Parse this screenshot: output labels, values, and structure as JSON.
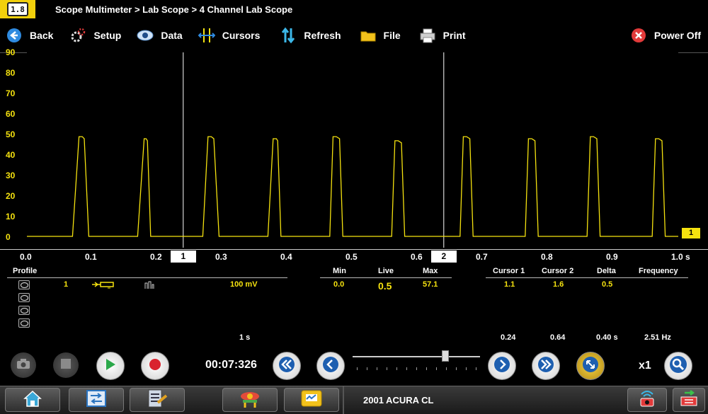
{
  "title_bar": {
    "breadcrumb": "Scope Multimeter > Lab Scope > 4 Channel Lab Scope",
    "app_icon": "multimeter-icon"
  },
  "toolbar": {
    "back": "Back",
    "setup": "Setup",
    "data": "Data",
    "cursors": "Cursors",
    "refresh": "Refresh",
    "file": "File",
    "print": "Print",
    "power_off": "Power Off"
  },
  "chart_data": {
    "type": "line",
    "series": [
      {
        "name": "1",
        "color": "#f5e20f",
        "x": [
          0.0,
          0.07,
          0.08,
          0.085,
          0.088,
          0.095,
          0.15,
          0.17,
          0.18,
          0.183,
          0.185,
          0.19,
          0.245,
          0.27,
          0.278,
          0.283,
          0.287,
          0.295,
          0.345,
          0.37,
          0.378,
          0.383,
          0.385,
          0.39,
          0.465,
          0.47,
          0.475,
          0.48,
          0.485,
          0.495,
          0.56,
          0.565,
          0.57,
          0.575,
          0.58,
          0.59,
          0.665,
          0.67,
          0.675,
          0.68,
          0.685,
          0.695,
          0.765,
          0.77,
          0.775,
          0.78,
          0.785,
          0.795,
          0.86,
          0.865,
          0.87,
          0.875,
          0.88,
          0.89,
          0.96,
          0.965,
          0.97,
          0.975,
          0.98,
          1.0
        ],
        "y": [
          0.5,
          0.5,
          49,
          49,
          48,
          0.5,
          0.5,
          0.5,
          48,
          48,
          47,
          0.5,
          0.5,
          0.5,
          49,
          49,
          48,
          0.5,
          0.5,
          0.5,
          48,
          48,
          47,
          0.5,
          0.5,
          49,
          49,
          48,
          0.5,
          0.5,
          0.5,
          47,
          47,
          46,
          0.5,
          0.5,
          0.5,
          49,
          49,
          48,
          0.5,
          0.5,
          0.5,
          48,
          48,
          47,
          0.5,
          0.5,
          0.5,
          49,
          49,
          48,
          0.5,
          0.5,
          0.5,
          48,
          48,
          47,
          0.5,
          0.5
        ]
      }
    ],
    "xlim": [
      0,
      1.0
    ],
    "ylim": [
      -5,
      90
    ],
    "x_ticks": [
      "0.0",
      "0.1",
      "0.2",
      "0.3",
      "0.4",
      "0.5",
      "0.6",
      "0.7",
      "0.8",
      "0.9",
      "1.0 s"
    ],
    "y_ticks": [
      "90",
      "80",
      "70",
      "60",
      "50",
      "40",
      "30",
      "20",
      "10",
      "0"
    ],
    "cursor1_x": 0.24,
    "cursor2_x": 0.64,
    "cursor1_label": "1",
    "cursor2_label": "2",
    "channel_label": "1",
    "trace_color": "#f5e20f",
    "grid": false
  },
  "info": {
    "profile_header": "Profile",
    "channel_no": "1",
    "scale": "100 mV",
    "min_header": "Min",
    "live_header": "Live",
    "max_header": "Max",
    "min": "0.0",
    "live": "0.5",
    "max": "57.1",
    "cursor1_header": "Cursor 1",
    "cursor2_header": "Cursor 2",
    "delta_header": "Delta",
    "frequency_header": "Frequency",
    "cursor1": "1.1",
    "cursor2": "1.6",
    "delta": "0.5",
    "frequency": "",
    "sweep": "1 s",
    "cursor1_time": "0.24",
    "cursor2_time": "0.64",
    "delta_time": "0.40 s",
    "frequency_value": "2.51 Hz"
  },
  "controls": {
    "elapsed": "00:07:326",
    "zoom_level": "x1",
    "slider_position": 0.73
  },
  "taskbar": {
    "vehicle": "2001 ACURA CL"
  }
}
